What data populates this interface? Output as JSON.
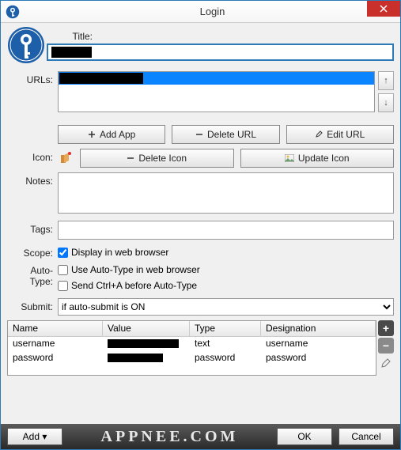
{
  "window": {
    "title": "Login"
  },
  "labels": {
    "title": "Title:",
    "urls": "URLs:",
    "icon": "Icon:",
    "notes": "Notes:",
    "tags": "Tags:",
    "scope": "Scope:",
    "autotype": "Auto-Type:",
    "submit": "Submit:"
  },
  "title_value": "",
  "urls": {
    "selected": ""
  },
  "buttons": {
    "addapp": "Add App",
    "deleteurl": "Delete URL",
    "editurl": "Edit URL",
    "deleteicon": "Delete Icon",
    "updateicon": "Update Icon"
  },
  "scope": {
    "display": "Display in web browser",
    "checked": true
  },
  "autotype": {
    "use": "Use Auto-Type in web browser",
    "useChecked": false,
    "ctrl": "Send Ctrl+A before Auto-Type",
    "ctrlChecked": false
  },
  "submit": {
    "value": "if auto-submit is ON"
  },
  "table": {
    "headers": {
      "name": "Name",
      "value": "Value",
      "type": "Type",
      "designation": "Designation"
    },
    "rows": [
      {
        "name": "username",
        "value": "",
        "type": "text",
        "designation": "username"
      },
      {
        "name": "password",
        "value": "",
        "type": "password",
        "designation": "password"
      }
    ]
  },
  "footer": {
    "add": "Add ▾",
    "ok": "OK",
    "cancel": "Cancel",
    "brand": "APPNEE.COM"
  }
}
